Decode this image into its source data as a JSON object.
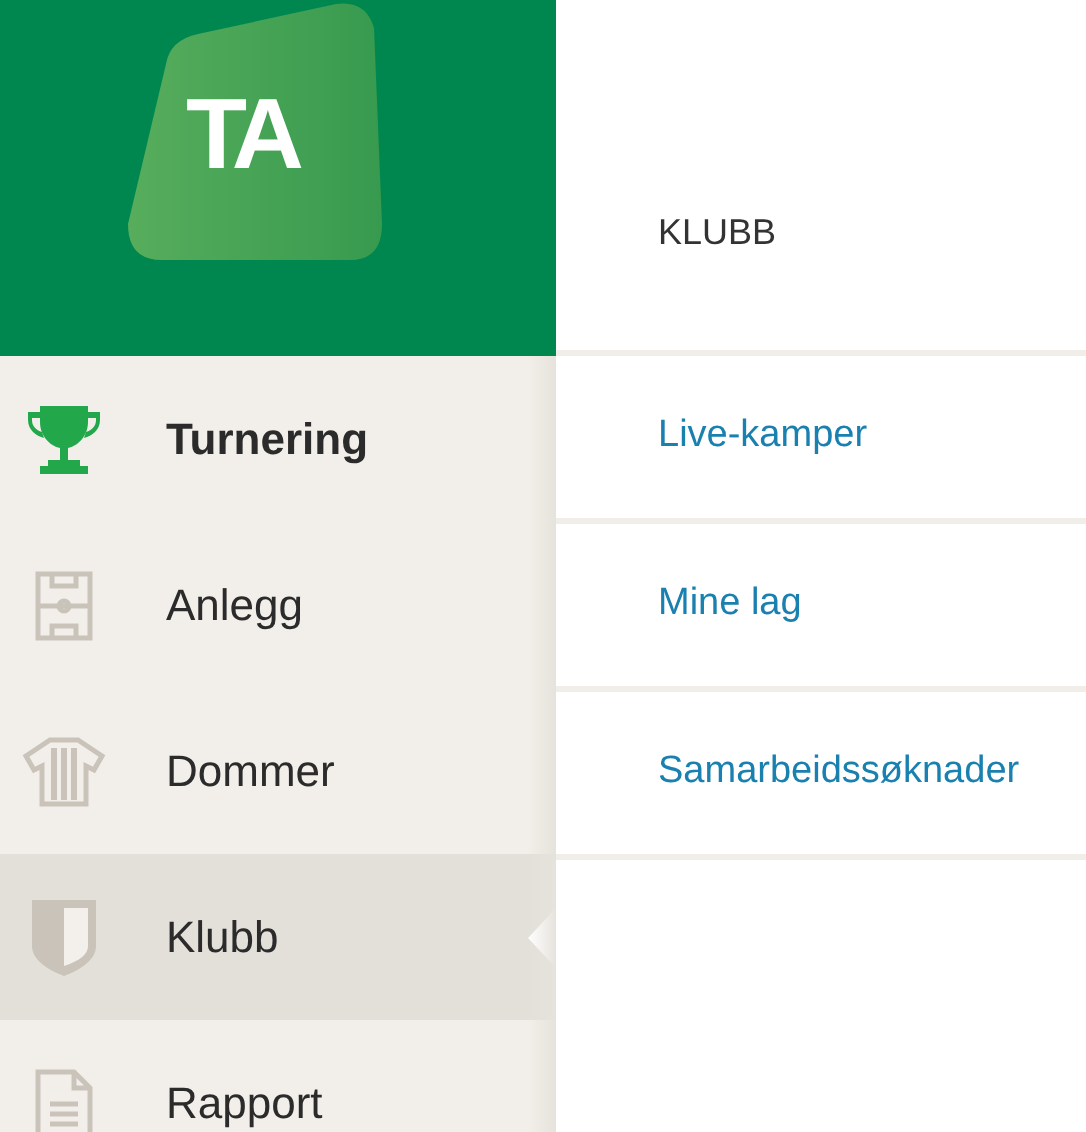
{
  "logo": {
    "text": "TA"
  },
  "sidebar": {
    "items": [
      {
        "label": "Turnering",
        "kind": "trophy",
        "current": true,
        "selected": false
      },
      {
        "label": "Anlegg",
        "kind": "pitch",
        "current": false,
        "selected": false
      },
      {
        "label": "Dommer",
        "kind": "shirt",
        "current": false,
        "selected": false
      },
      {
        "label": "Klubb",
        "kind": "shield",
        "current": false,
        "selected": true
      },
      {
        "label": "Rapport",
        "kind": "document",
        "current": false,
        "selected": false
      }
    ]
  },
  "submenu": {
    "title": "KLUBB",
    "links": [
      "Live-kamper",
      "Mine lag",
      "Samarbeidssøknader"
    ]
  }
}
